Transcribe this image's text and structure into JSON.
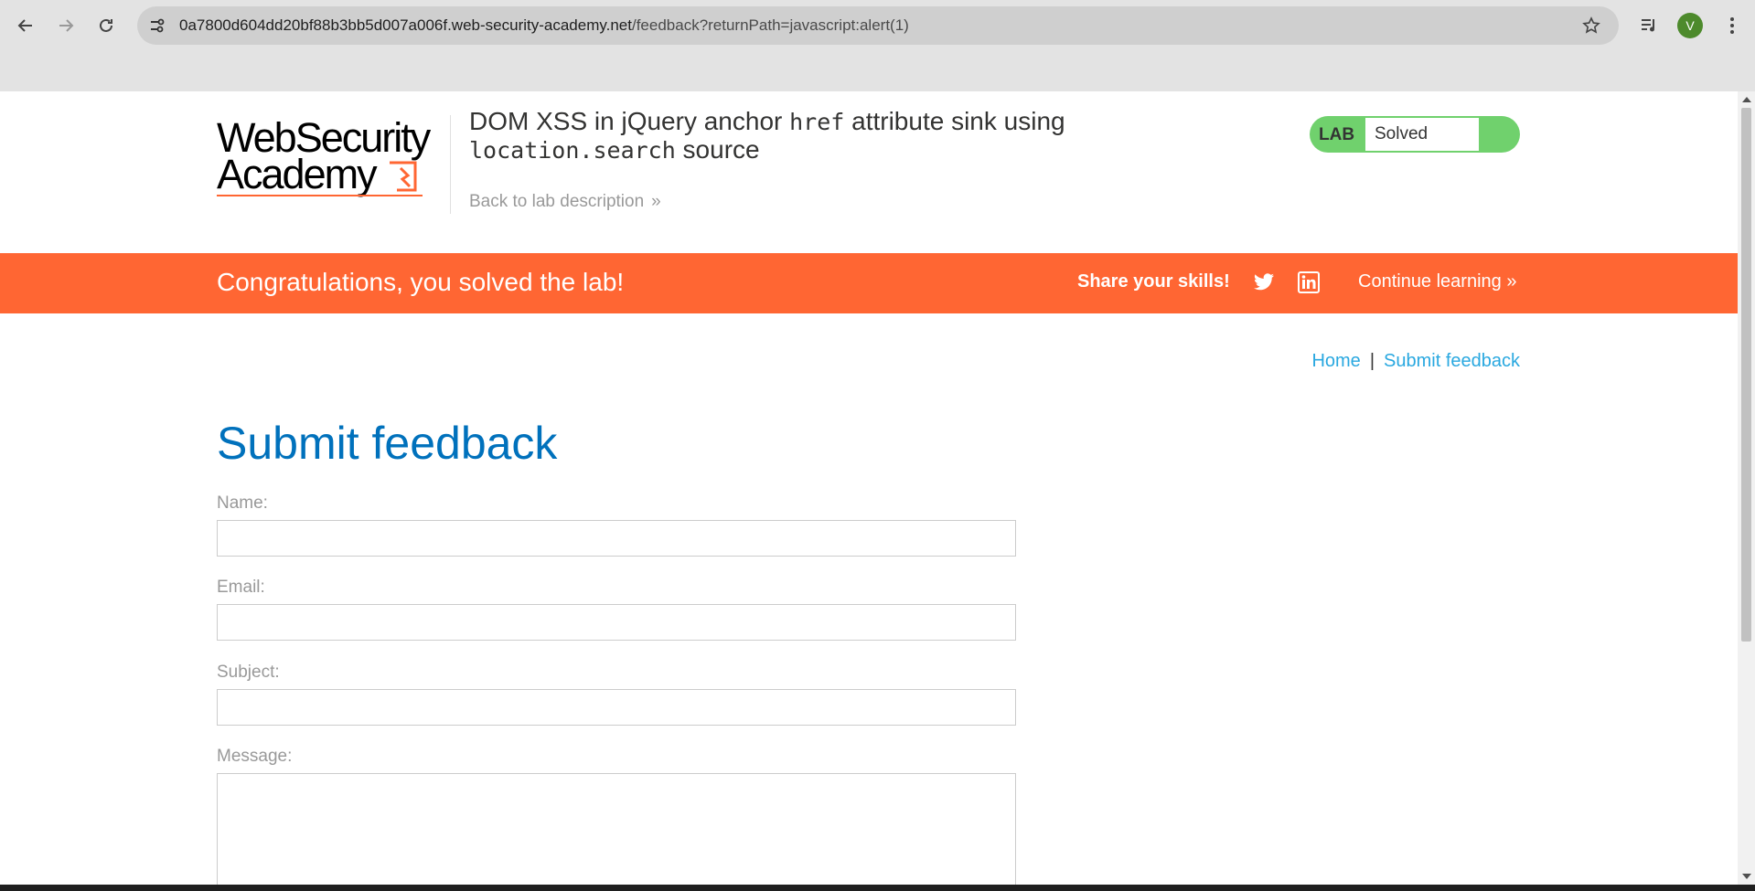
{
  "browser": {
    "url_host": "0a7800d604dd20bf88b3bb5d007a006f.web-security-academy.net",
    "url_path": "/feedback?returnPath=javascript:alert(1)",
    "profile_initial": "V",
    "icons": [
      "back-arrow-icon",
      "forward-arrow-icon",
      "reload-icon",
      "site-info-icon",
      "star-icon",
      "media-control-icon",
      "menu-dots-icon"
    ]
  },
  "header": {
    "logo_line1": "WebSecurity",
    "logo_line2": "Academy",
    "title_part1": "DOM XSS in jQuery anchor ",
    "title_code1": "href",
    "title_part2": " attribute sink using ",
    "title_code2": "location.search",
    "title_part3": " source",
    "back_link": "Back to lab description",
    "back_chevron": "»",
    "lab_label": "LAB",
    "lab_status": "Solved",
    "status_color": "#70d16d"
  },
  "banner": {
    "message": "Congratulations, you solved the lab!",
    "share_text": "Share your skills!",
    "continue_text": "Continue learning",
    "continue_chevron": "»",
    "color": "#ff6633"
  },
  "breadcrumb": {
    "home": "Home",
    "separator": "|",
    "current": "Submit feedback"
  },
  "form": {
    "title": "Submit feedback",
    "name_label": "Name:",
    "name_value": "",
    "email_label": "Email:",
    "email_value": "",
    "subject_label": "Subject:",
    "subject_value": "",
    "message_label": "Message:",
    "message_value": ""
  }
}
